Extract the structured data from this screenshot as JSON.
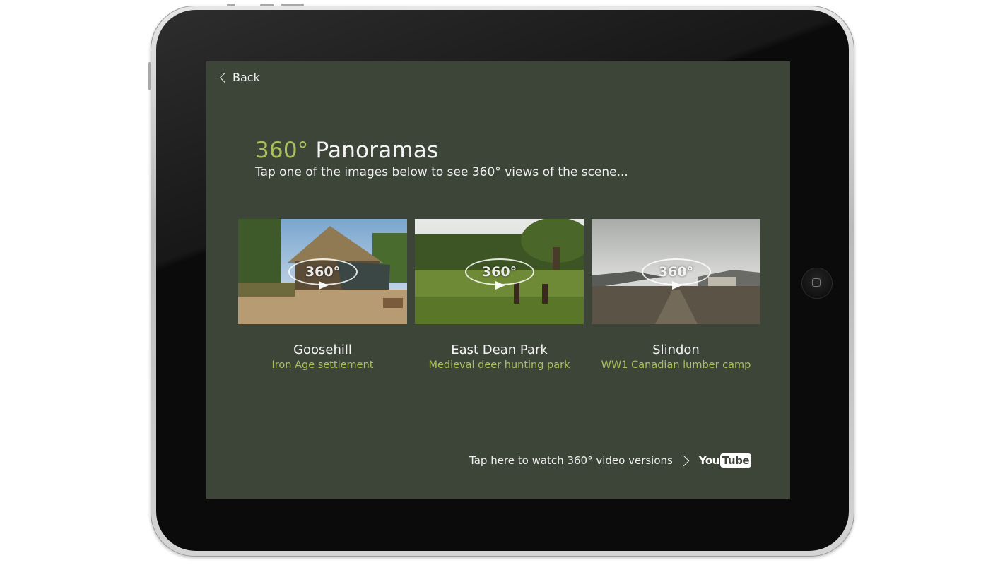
{
  "app": {
    "back_label": "Back"
  },
  "header": {
    "title_accent": "360°",
    "title_main": "Panoramas",
    "subtitle": "Tap one of the images below to see 360° views of the scene..."
  },
  "panoramas": [
    {
      "name": "Goosehill",
      "description": "Iron Age settlement",
      "badge": "360°"
    },
    {
      "name": "East Dean Park",
      "description": "Medieval deer hunting park",
      "badge": "360°"
    },
    {
      "name": "Slindon",
      "description": "WW1 Canadian lumber camp",
      "badge": "360°"
    }
  ],
  "footer": {
    "video_link_label": "Tap here to watch 360° video versions",
    "youtube_you": "You",
    "youtube_tube": "Tube"
  },
  "colors": {
    "screen_background": "#3d4539",
    "accent_green": "#a8c05a",
    "text": "#f2f2f2"
  },
  "icons": [
    "back-chevron-icon",
    "home-button-icon",
    "video-chevron-icon",
    "youtube-logo-icon",
    "rotate-360-icon"
  ]
}
